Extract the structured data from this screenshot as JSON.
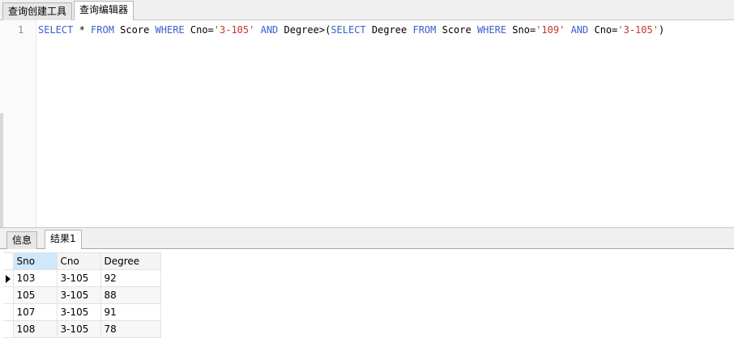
{
  "top_tabs": [
    "查询创建工具",
    "查询编辑器"
  ],
  "editor": {
    "line_number": "1",
    "tokens": [
      {
        "t": "SELECT",
        "k": "kw"
      },
      {
        "t": " * ",
        "k": ""
      },
      {
        "t": "FROM",
        "k": "kw"
      },
      {
        "t": " Score ",
        "k": ""
      },
      {
        "t": "WHERE",
        "k": "kw"
      },
      {
        "t": " Cno=",
        "k": ""
      },
      {
        "t": "'3-105'",
        "k": "str"
      },
      {
        "t": " ",
        "k": ""
      },
      {
        "t": "AND",
        "k": "kw"
      },
      {
        "t": " Degree>(",
        "k": ""
      },
      {
        "t": "SELECT",
        "k": "kw"
      },
      {
        "t": " Degree ",
        "k": ""
      },
      {
        "t": "FROM",
        "k": "kw"
      },
      {
        "t": " Score ",
        "k": ""
      },
      {
        "t": "WHERE",
        "k": "kw"
      },
      {
        "t": " Sno=",
        "k": ""
      },
      {
        "t": "'109'",
        "k": "str"
      },
      {
        "t": " ",
        "k": ""
      },
      {
        "t": "AND",
        "k": "kw"
      },
      {
        "t": " Cno=",
        "k": ""
      },
      {
        "t": "'3-105'",
        "k": "str"
      },
      {
        "t": ")",
        "k": ""
      }
    ]
  },
  "bottom_tabs": [
    "信息",
    "结果1"
  ],
  "result": {
    "columns": [
      "Sno",
      "Cno",
      "Degree"
    ],
    "rows": [
      [
        "103",
        "3-105",
        "92"
      ],
      [
        "105",
        "3-105",
        "88"
      ],
      [
        "107",
        "3-105",
        "91"
      ],
      [
        "108",
        "3-105",
        "78"
      ]
    ],
    "current_row_icon": "row-pointer-icon"
  },
  "colors": {
    "keyword": "#3a5fcd",
    "string": "#c0392b",
    "selected_header": "#cfe8fb"
  }
}
